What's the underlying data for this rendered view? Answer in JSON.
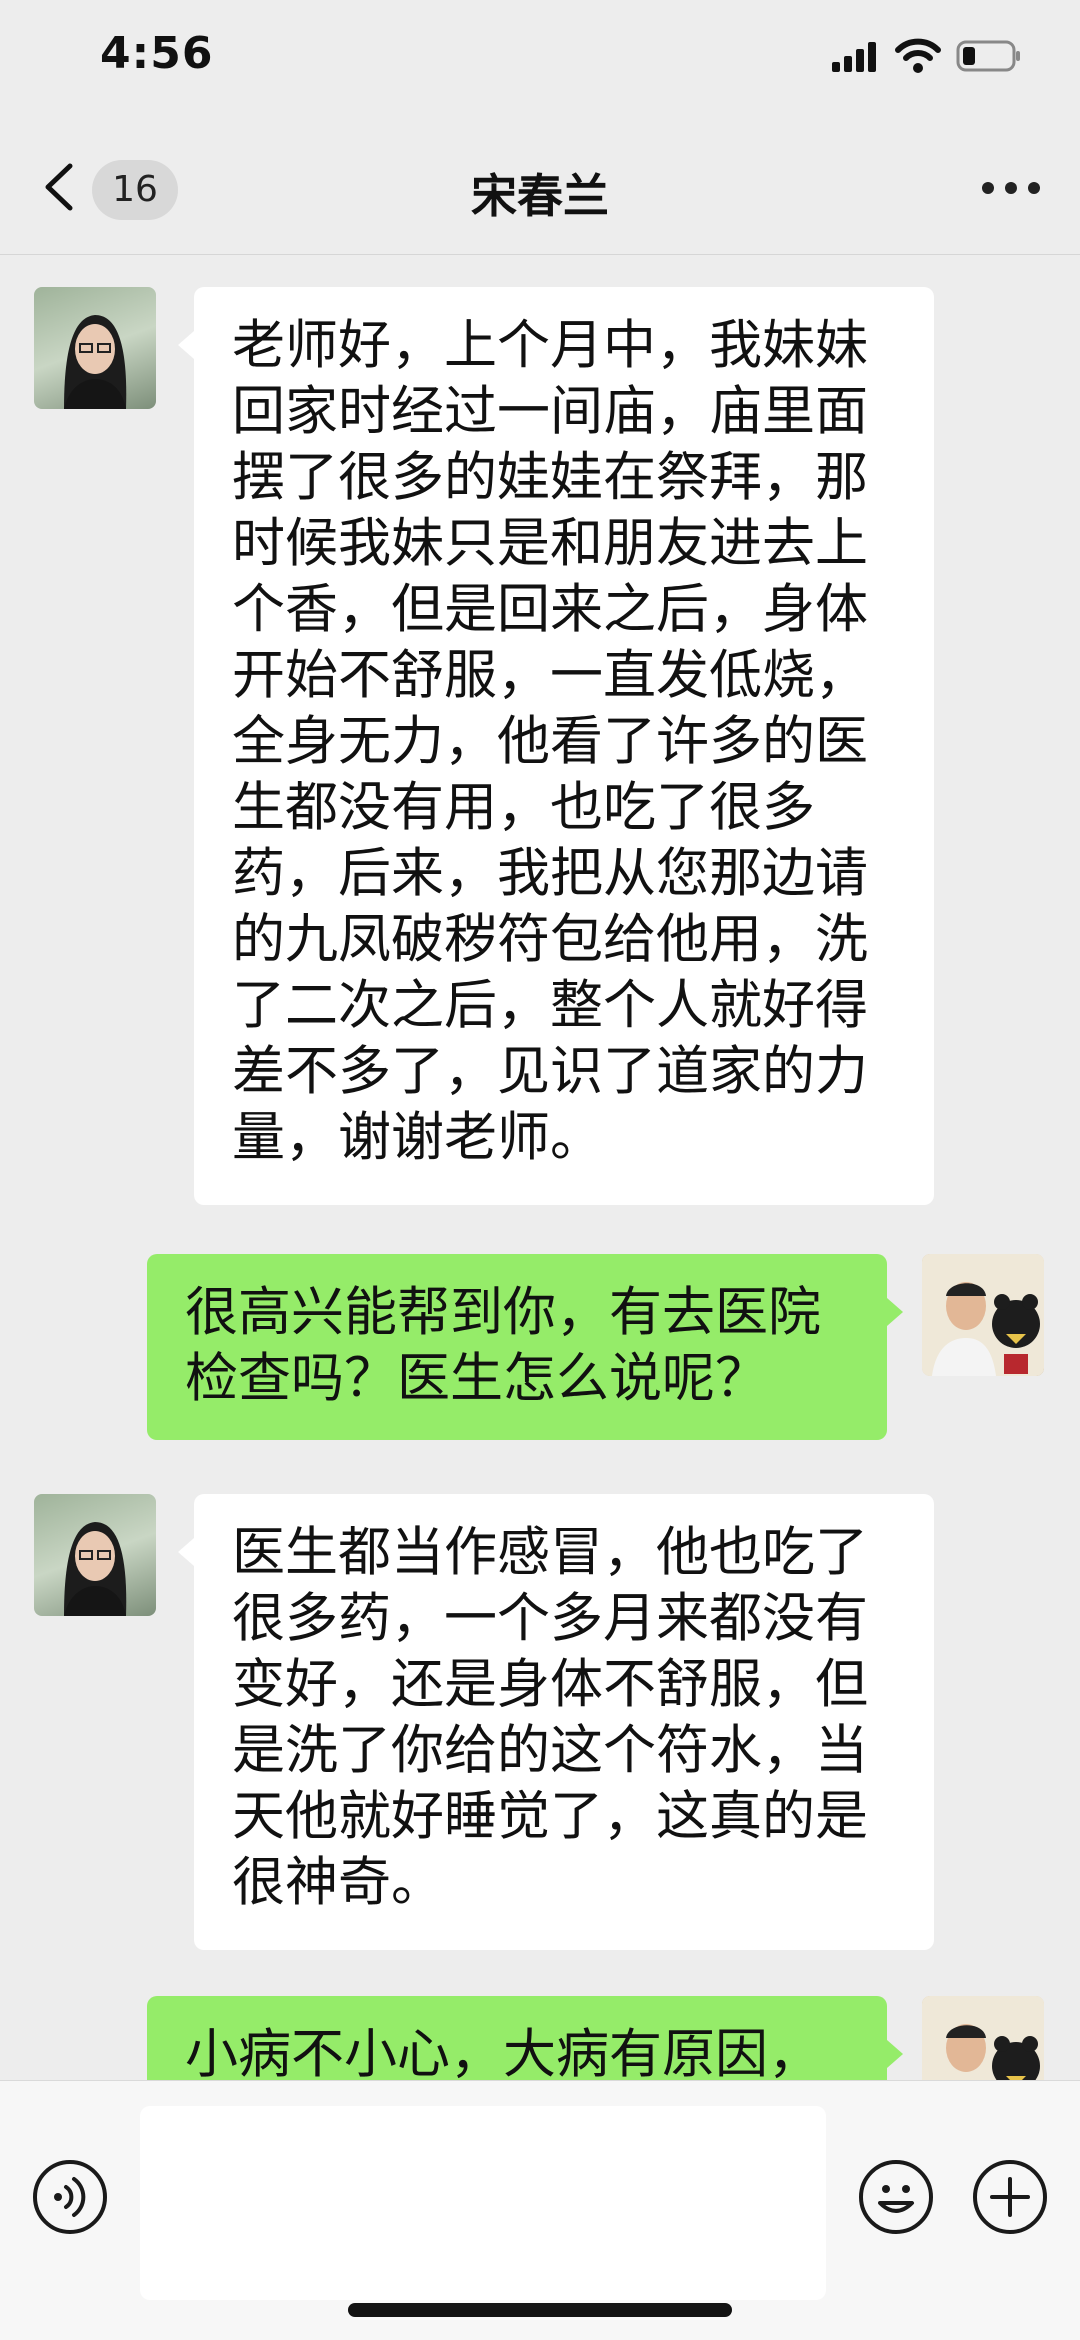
{
  "status_bar": {
    "time": "4:56"
  },
  "nav": {
    "unread_count": "16",
    "title": "宋春兰"
  },
  "messages": [
    {
      "side": "in",
      "text": "老师好，上个月中，我妹妹\n回家时经过一间庙，庙里面\n摆了很多的娃娃在祭拜，那\n时候我妹只是和朋友进去上\n个香，但是回来之后，身体\n开始不舒服，一直发低烧，\n全身无力，他看了许多的医\n生都没有用，也吃了很多\n药，后来，我把从您那边请\n的九凤破秽符包给他用，洗\n了二次之后，整个人就好得\n差不多了，见识了道家的力\n量，谢谢老师。"
    },
    {
      "side": "out",
      "text": "很高兴能帮到你，有去医院\n检查吗？医生怎么说呢？"
    },
    {
      "side": "in",
      "text": "医生都当作感冒，他也吃了\n很多药，一个多月来都没有\n变好，还是身体不舒服，但\n是洗了你给的这个符水，当\n天他就好睡觉了，这真的是\n很神奇。"
    },
    {
      "side": "out",
      "text": "小病不小心，大病有原因，"
    }
  ],
  "icons": {
    "back": "chevron-left-icon",
    "more": "more-dots-icon",
    "voice": "voice-icon",
    "emoji": "emoji-icon",
    "plus": "plus-icon"
  },
  "colors": {
    "background": "#ededed",
    "incoming_bubble": "#ffffff",
    "outgoing_bubble": "#95ec69"
  },
  "input": {
    "value": ""
  }
}
